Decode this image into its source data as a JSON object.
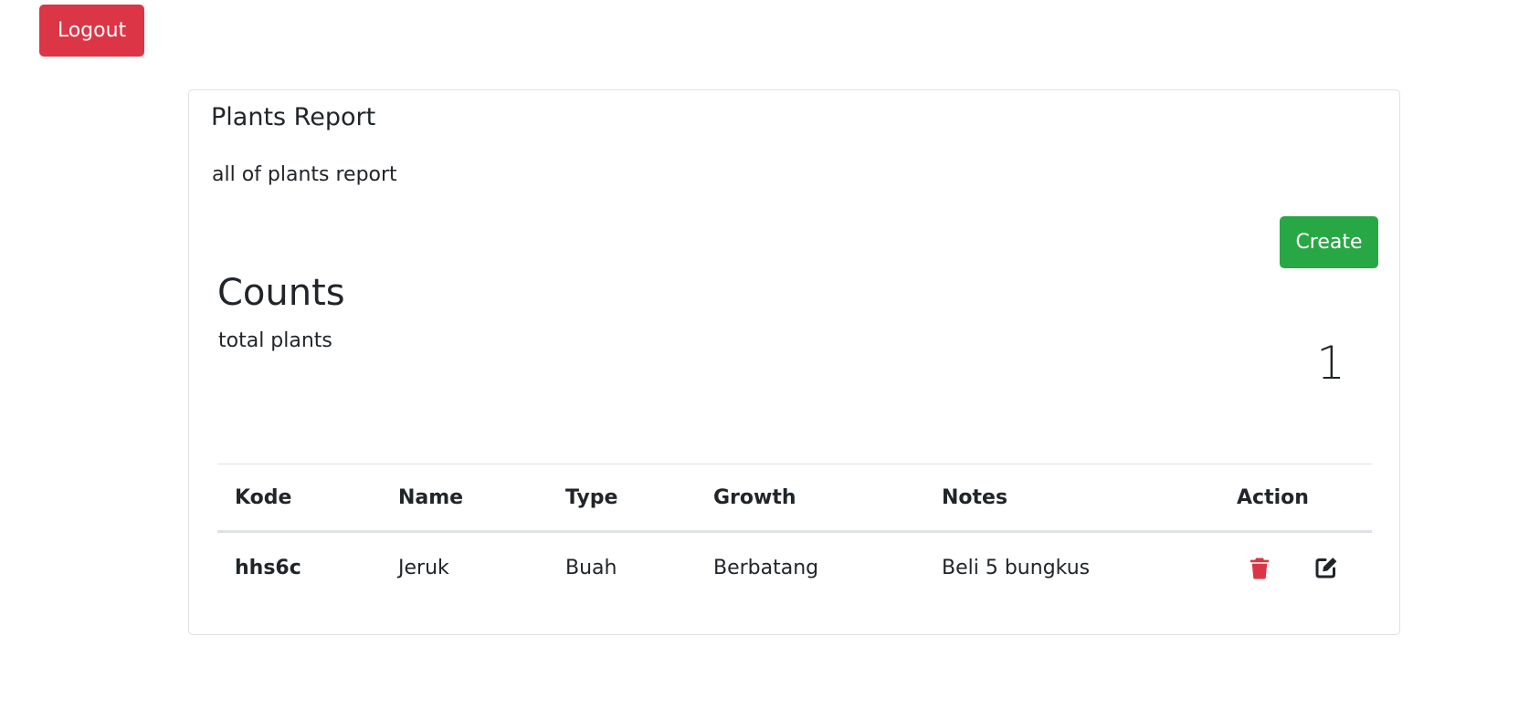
{
  "header": {
    "logout_label": "Logout"
  },
  "card": {
    "title": "Plants Report",
    "subtitle": "all of plants report",
    "create_label": "Create"
  },
  "counts": {
    "heading": "Counts",
    "label": "total plants",
    "value": "1"
  },
  "table": {
    "columns": [
      "Kode",
      "Name",
      "Type",
      "Growth",
      "Notes",
      "Action"
    ],
    "rows": [
      {
        "kode": "hhs6c",
        "name": "Jeruk",
        "type": "Buah",
        "growth": "Berbatang",
        "notes": "Beli 5 bungkus",
        "actions": [
          "trash-icon",
          "edit-icon"
        ]
      }
    ]
  },
  "colors": {
    "danger": "#dc3545",
    "success": "#28a745",
    "text": "#212529",
    "border": "#dee2e6"
  }
}
